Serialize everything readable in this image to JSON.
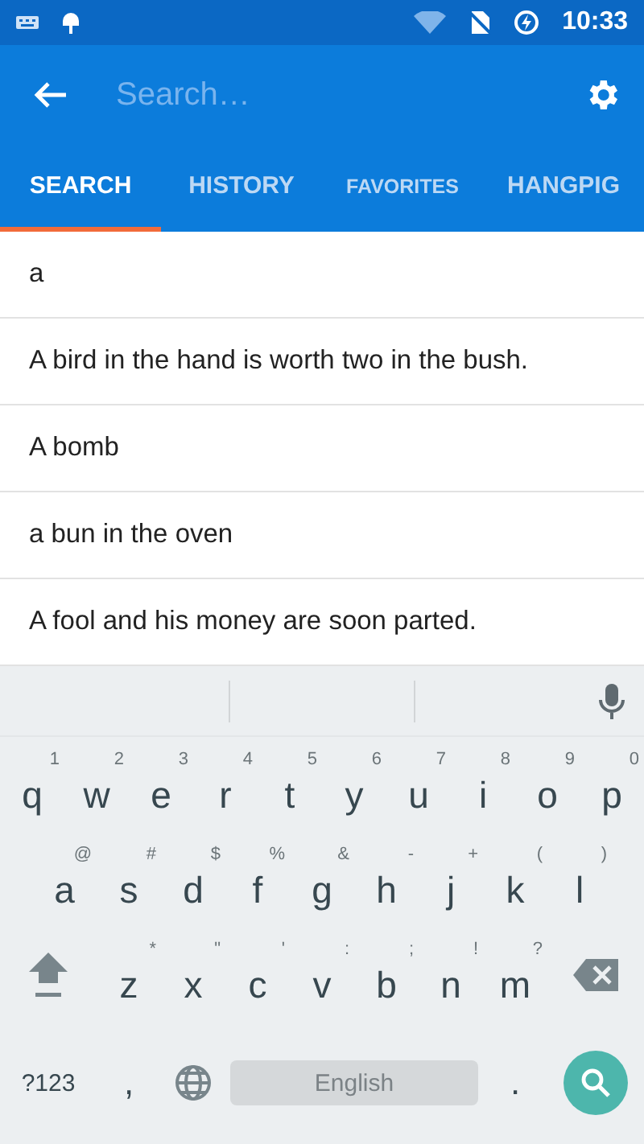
{
  "status_bar": {
    "time": "10:33"
  },
  "app_bar": {
    "search": {
      "placeholder": "Search…"
    }
  },
  "tabs": [
    {
      "label": "SEARCH",
      "selected": true
    },
    {
      "label": "HISTORY",
      "selected": false
    },
    {
      "label": "FAVORITES",
      "selected": false
    },
    {
      "label": "HANGPIG",
      "selected": false
    }
  ],
  "results": [
    "a",
    "A bird in the hand is worth two in the bush.",
    "A bomb",
    "a bun in the oven",
    "A fool and his money are soon parted."
  ],
  "keyboard": {
    "rows": [
      [
        {
          "label": "q",
          "hint": "1"
        },
        {
          "label": "w",
          "hint": "2"
        },
        {
          "label": "e",
          "hint": "3"
        },
        {
          "label": "r",
          "hint": "4"
        },
        {
          "label": "t",
          "hint": "5"
        },
        {
          "label": "y",
          "hint": "6"
        },
        {
          "label": "u",
          "hint": "7"
        },
        {
          "label": "i",
          "hint": "8"
        },
        {
          "label": "o",
          "hint": "9"
        },
        {
          "label": "p",
          "hint": "0"
        }
      ],
      [
        {
          "label": "a",
          "hint": "@"
        },
        {
          "label": "s",
          "hint": "#"
        },
        {
          "label": "d",
          "hint": "$"
        },
        {
          "label": "f",
          "hint": "%"
        },
        {
          "label": "g",
          "hint": "&"
        },
        {
          "label": "h",
          "hint": "-"
        },
        {
          "label": "j",
          "hint": "+"
        },
        {
          "label": "k",
          "hint": "("
        },
        {
          "label": "l",
          "hint": ")"
        }
      ],
      [
        {
          "label": "z",
          "hint": "*"
        },
        {
          "label": "x",
          "hint": "\""
        },
        {
          "label": "c",
          "hint": "'"
        },
        {
          "label": "v",
          "hint": ":"
        },
        {
          "label": "b",
          "hint": ";"
        },
        {
          "label": "n",
          "hint": "!"
        },
        {
          "label": "m",
          "hint": "?"
        }
      ]
    ],
    "symbols_key": "?123",
    "comma_key": ",",
    "space_key": "English",
    "period_key": "."
  }
}
